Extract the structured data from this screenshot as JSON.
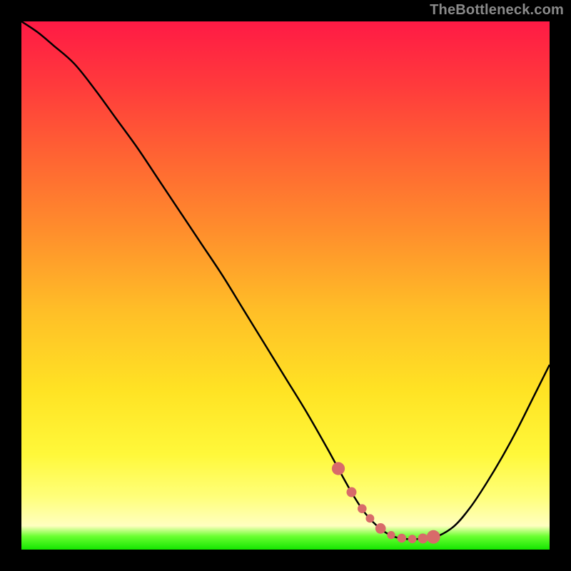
{
  "watermark": "TheBottleneck.com",
  "colors": {
    "page_bg": "#000000",
    "curve": "#000000",
    "marker": "#d86a6a"
  },
  "gradient_stops": [
    {
      "offset": 0.0,
      "color": "#ff1a45"
    },
    {
      "offset": 0.12,
      "color": "#ff3a3c"
    },
    {
      "offset": 0.25,
      "color": "#ff6233"
    },
    {
      "offset": 0.4,
      "color": "#ff8f2c"
    },
    {
      "offset": 0.55,
      "color": "#ffbf27"
    },
    {
      "offset": 0.7,
      "color": "#ffe324"
    },
    {
      "offset": 0.82,
      "color": "#fff83a"
    },
    {
      "offset": 0.9,
      "color": "#ffff7a"
    },
    {
      "offset": 0.955,
      "color": "#ffffc0"
    },
    {
      "offset": 0.975,
      "color": "#6aff30"
    },
    {
      "offset": 1.0,
      "color": "#14e600"
    }
  ],
  "chart_data": {
    "type": "line",
    "title": "",
    "xlabel": "",
    "ylabel": "",
    "xlim": [
      0,
      100
    ],
    "ylim": [
      0,
      100
    ],
    "optimal_range_x": [
      60,
      78
    ],
    "series": [
      {
        "name": "bottleneck",
        "x": [
          0,
          3,
          6,
          10,
          14,
          18,
          22,
          26,
          30,
          34,
          38,
          42,
          46,
          50,
          54,
          58,
          61,
          63,
          65,
          67,
          69,
          71,
          73,
          75,
          77,
          79,
          82,
          85,
          88,
          91,
          94,
          97,
          100
        ],
        "y": [
          100,
          98,
          95.5,
          92,
          87,
          81.5,
          76,
          70,
          64,
          58,
          52,
          45.5,
          39,
          32.5,
          26,
          19,
          13.5,
          10,
          7,
          4.8,
          3.2,
          2.3,
          2.0,
          2.0,
          2.2,
          2.6,
          4.5,
          8,
          12.5,
          17.5,
          23,
          29,
          35
        ]
      }
    ],
    "markers": {
      "name": "optimal",
      "x": [
        60,
        62.5,
        64.5,
        66,
        68,
        70,
        72,
        74,
        76,
        78
      ],
      "size_multiplier": [
        1.3,
        1.0,
        0.9,
        0.85,
        1.05,
        0.8,
        0.9,
        0.85,
        1.0,
        1.35
      ]
    }
  }
}
